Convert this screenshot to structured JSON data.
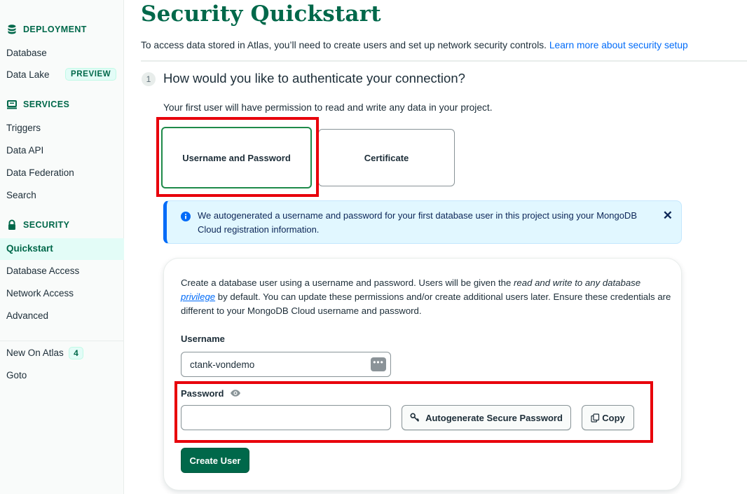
{
  "sidebar": {
    "deployment": {
      "heading": "DEPLOYMENT",
      "icon": "database-icon",
      "items": [
        {
          "label": "Database"
        },
        {
          "label": "Data Lake",
          "badge": "PREVIEW"
        }
      ]
    },
    "services": {
      "heading": "SERVICES",
      "icon": "services-icon",
      "items": [
        {
          "label": "Triggers"
        },
        {
          "label": "Data API"
        },
        {
          "label": "Data Federation"
        },
        {
          "label": "Search"
        }
      ]
    },
    "security": {
      "heading": "SECURITY",
      "icon": "lock-icon",
      "items": [
        {
          "label": "Quickstart",
          "active": true
        },
        {
          "label": "Database Access"
        },
        {
          "label": "Network Access"
        },
        {
          "label": "Advanced"
        }
      ]
    },
    "extra": [
      {
        "label": "New On Atlas",
        "badge": "4"
      },
      {
        "label": "Goto"
      }
    ]
  },
  "page": {
    "title": "Security Quickstart",
    "intro": "To access data stored in Atlas, you’ll need to create users and set up network security controls.",
    "intro_link": "Learn more about security setup"
  },
  "step": {
    "number": "1",
    "title": "How would you like to authenticate your connection?",
    "subtitle": "Your first user will have permission to read and write any data in your project.",
    "options": [
      {
        "label": "Username and Password",
        "selected": true
      },
      {
        "label": "Certificate",
        "selected": false
      }
    ]
  },
  "banner": {
    "text": "We autogenerated a username and password for your first database user in this project using your MongoDB Cloud registration information.",
    "close": "✕"
  },
  "form": {
    "desc_pre": "Create a database user using a username and password. Users will be given the ",
    "desc_em": "read and write to any database",
    "desc_link": "privilege",
    "desc_post": " by default. You can update these permissions and/or create additional users later. Ensure these credentials are different to your MongoDB Cloud username and password.",
    "username_label": "Username",
    "username_value": "ctank-vondemo",
    "password_label": "Password",
    "password_value": "",
    "autogen_label": "Autogenerate Secure Password",
    "copy_label": "Copy",
    "create_label": "Create User"
  },
  "colors": {
    "brand_green": "#00684a",
    "link_blue": "#016bf8",
    "highlight_red": "#e8000b",
    "selected_border": "#1e8a4a"
  }
}
